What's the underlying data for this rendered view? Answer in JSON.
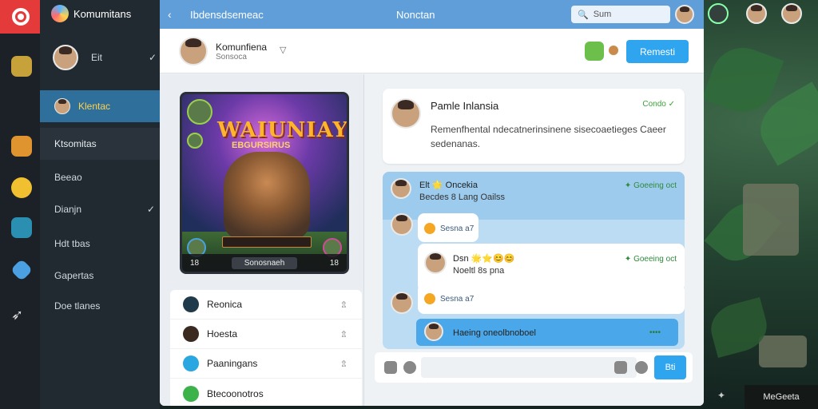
{
  "app": {
    "brand": "Komumitans",
    "topbar_crumb": "Ibdensdsemeac",
    "topbar_title": "Nonctan",
    "search_placeholder": "Sum"
  },
  "sidebar": {
    "profile_name": "Eit",
    "items": [
      {
        "label": "Klentac",
        "active": true
      },
      {
        "label": "Ktsomitas"
      },
      {
        "label": "Beeao"
      },
      {
        "label": "Dianjn",
        "checked": true
      },
      {
        "label": "Hdt tbas"
      },
      {
        "label": "Gapertas"
      },
      {
        "label": "Doe tlanes"
      }
    ]
  },
  "header": {
    "name": "Komunfiena",
    "sub": "Sonsoca",
    "primary_button": "Remesti"
  },
  "game_card": {
    "title": "WAIUNIAY",
    "subtitle": "EBGURSIRUS",
    "footer_left": "18",
    "footer_mid": "Sonosnaeh",
    "footer_right": "18"
  },
  "list": [
    {
      "label": "Reonica",
      "icon_color": "#1f3a4a"
    },
    {
      "label": "Hoesta",
      "icon_color": "#3a2a1f"
    },
    {
      "label": "Paaningans",
      "icon_color": "#2aa7e0"
    },
    {
      "label": "Btecoonotros",
      "icon_color": "#3bb34a"
    }
  ],
  "info_card": {
    "name": "Pamle Inlansia",
    "status": "Condo ✓",
    "description": "Remenfhental ndecatnerinsinene sisecoaetieges Caeer sedenanas."
  },
  "chat": {
    "header_name": "Elt 🌟 Oncekia",
    "header_sub": "Becdes 8 Lang Oailss",
    "header_status": "✦ Goeeing oct",
    "m1_pill": "Sesna a7",
    "m2_name": "Dsn 🌟⭐😊😊",
    "m2_text": "Noeltl 8s pna",
    "m2_status": "✦ Goeeing oct",
    "m3_pill": "Sesna a7",
    "m4_text": "Haeing oneolbnoboel",
    "m4_dots": "••••"
  },
  "composer": {
    "send_label": "Bti"
  },
  "corner_label": "MeGeeta"
}
